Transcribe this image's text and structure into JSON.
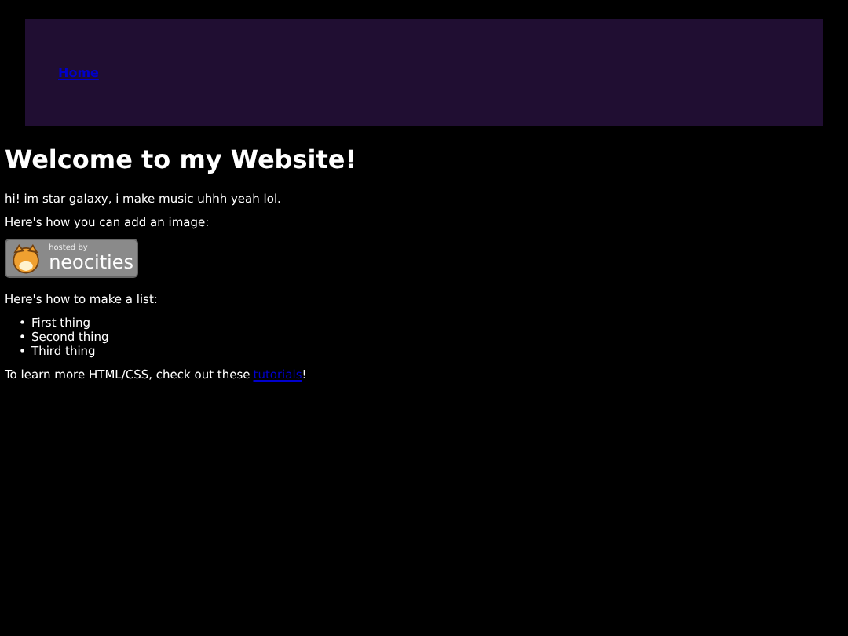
{
  "nav": {
    "links": [
      "Home"
    ]
  },
  "heading": "Welcome to my Website!",
  "intro": "hi! im star galaxy, i make music uhhh yeah lol.",
  "image_caption": "Here's how you can add an image:",
  "badge": {
    "small": "hosted by",
    "large": "neocities"
  },
  "list_caption": "Here's how to make a list:",
  "list": [
    {
      "marker": "•",
      "text": "First thing"
    },
    {
      "marker": "•",
      "text": "Second thing"
    },
    {
      "marker": "•",
      "text": "Third thing"
    }
  ],
  "outro": {
    "before": "To learn more HTML/CSS, check out these",
    "link": "tutorials",
    "after": "!"
  }
}
